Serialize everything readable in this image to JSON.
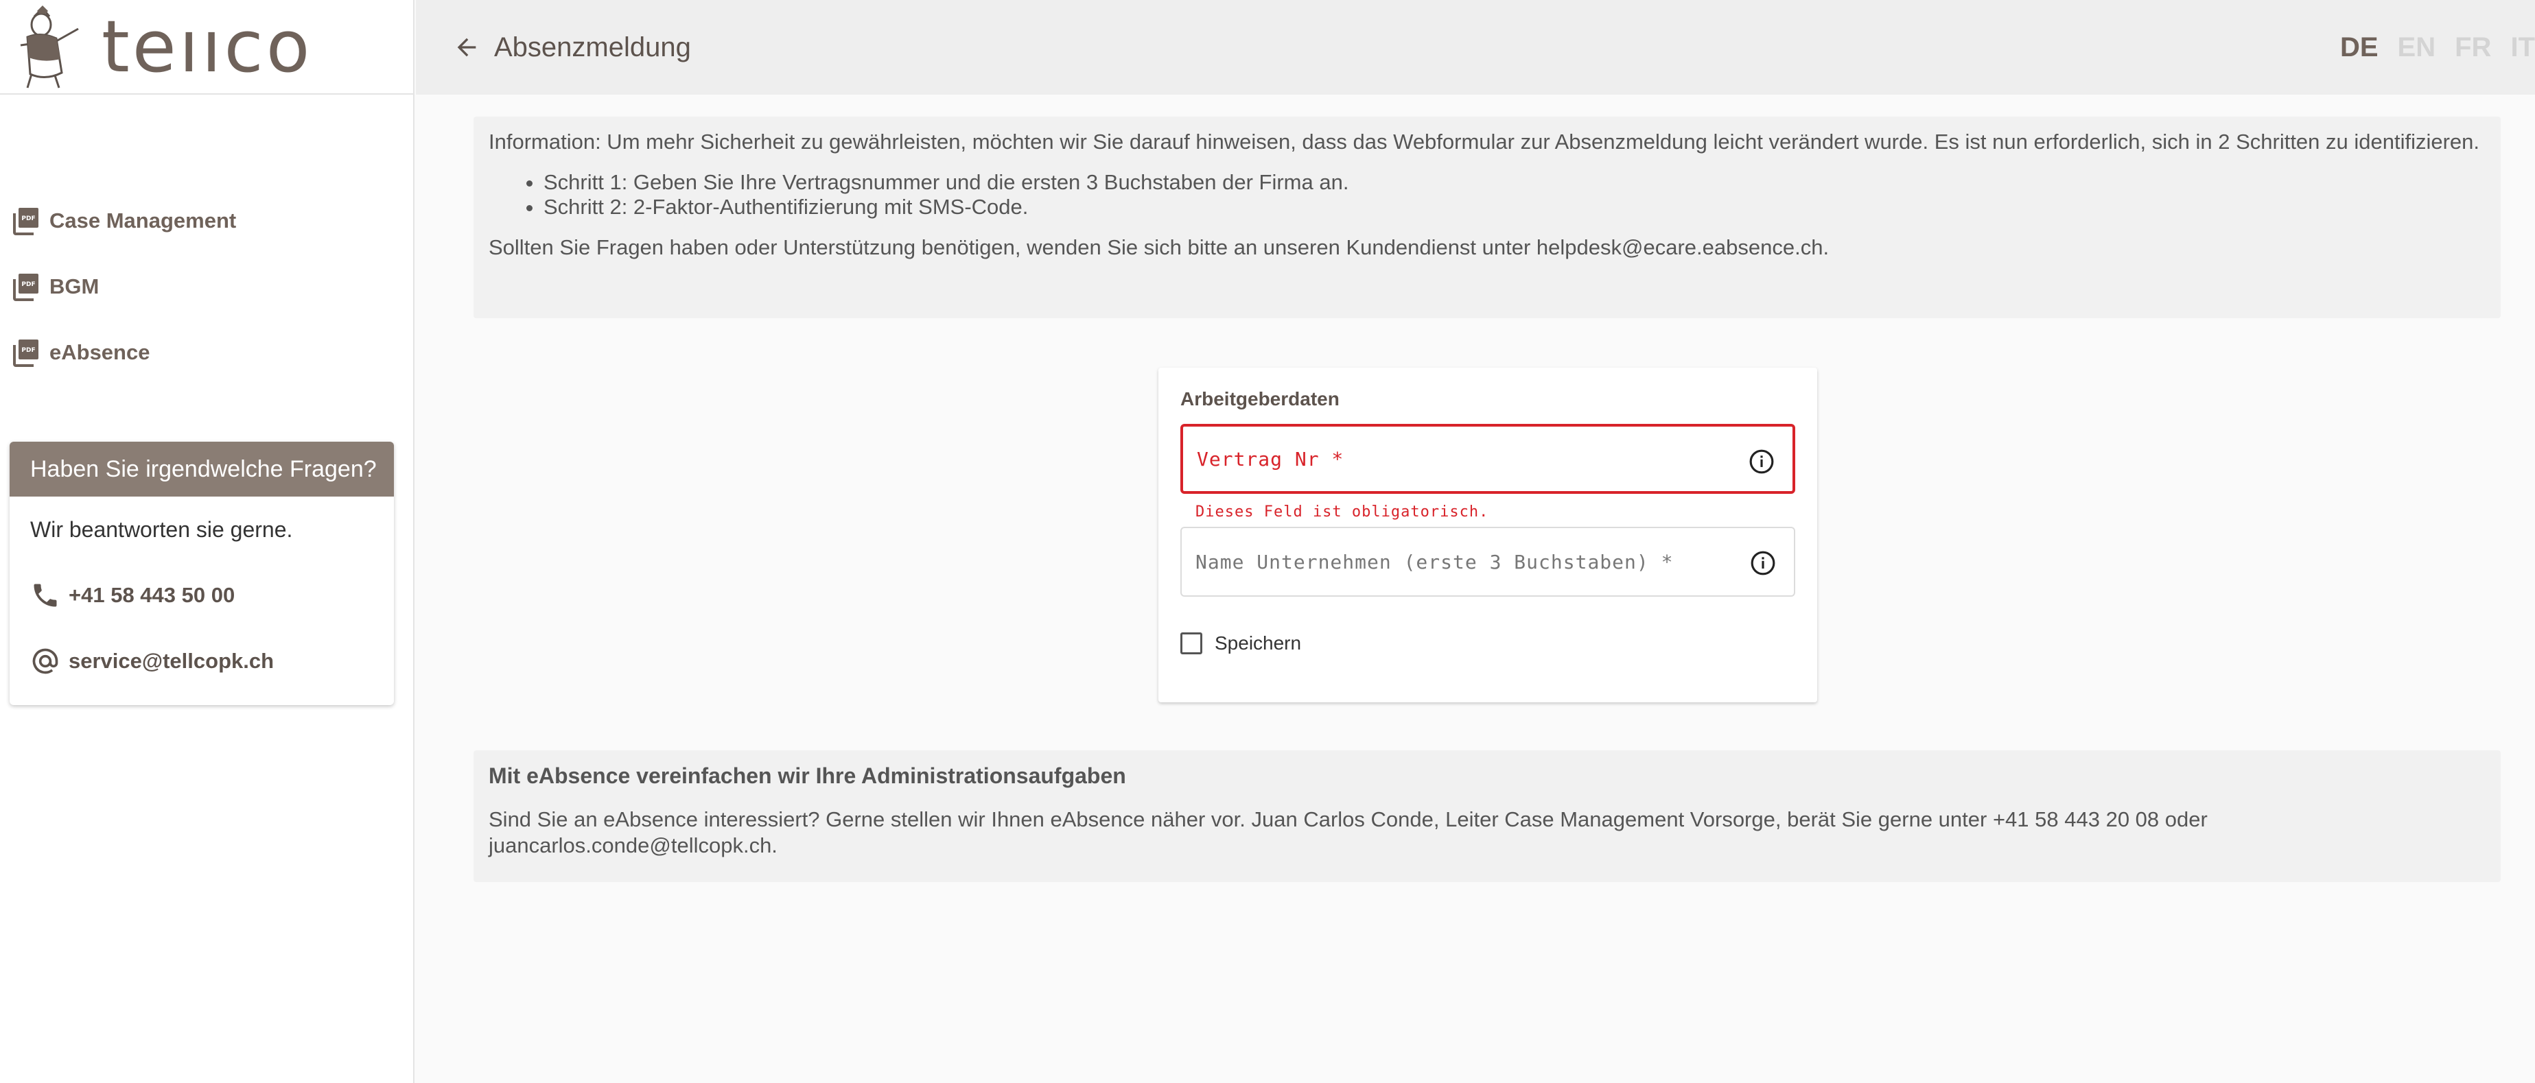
{
  "logo": {
    "text": "teııco"
  },
  "sidebar": {
    "items": [
      {
        "label": "Case Management",
        "icon": "pdf-icon"
      },
      {
        "label": "BGM",
        "icon": "pdf-icon"
      },
      {
        "label": "eAbsence",
        "icon": "pdf-icon"
      }
    ]
  },
  "help": {
    "title": "Haben Sie irgendwelche Fragen?",
    "subtitle": "Wir beantworten sie gerne.",
    "phone": "+41 58 443 50 00",
    "email": "service@tellcopk.ch"
  },
  "topbar": {
    "title": "Absenzmeldung",
    "languages": [
      "DE",
      "EN",
      "FR",
      "IT"
    ],
    "active_language": "DE"
  },
  "info": {
    "intro": "Information: Um mehr Sicherheit zu gewährleisten, möchten wir Sie darauf hinweisen, dass das Webformular zur Absenzmeldung leicht verändert wurde. Es ist nun erforderlich, sich in 2 Schritten zu identifizieren.",
    "steps": [
      "Schritt 1: Geben Sie Ihre Vertragsnummer und die ersten 3 Buchstaben der Firma an.",
      "Schritt 2: 2-Faktor-Authentifizierung mit SMS-Code."
    ],
    "closing": "Sollten Sie Fragen haben oder Unterstützung benötigen, wenden Sie sich bitte an unseren Kundendienst unter helpdesk@ecare.eabsence.ch."
  },
  "form": {
    "title": "Arbeitgeberdaten",
    "contract_label": "Vertrag Nr *",
    "contract_error": "Dieses Feld ist obligatorisch.",
    "company_label": "Name Unternehmen (erste 3 Buchstaben) *",
    "save_label": "Speichern"
  },
  "promo": {
    "title": "Mit eAbsence vereinfachen wir Ihre Administrationsaufgaben",
    "text": "Sind Sie an eAbsence interessiert? Gerne stellen wir Ihnen eAbsence näher vor. Juan Carlos Conde, Leiter Case Management Vorsorge, berät Sie gerne unter +41 58 443 20 08 oder juancarlos.conde@tellcopk.ch."
  },
  "colors": {
    "brand": "#6f625a",
    "help_header": "#8a7d74",
    "error": "#d8232a"
  }
}
